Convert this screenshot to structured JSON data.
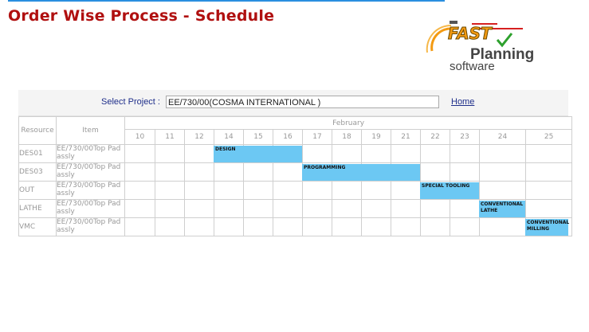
{
  "page": {
    "title": "Order Wise Process - Schedule"
  },
  "logo": {
    "word1": "FAST",
    "word2": "Planning",
    "word3": "software",
    "colors": {
      "orange": "#f39a12",
      "green": "#2ea12e",
      "red": "#d62020"
    }
  },
  "selector": {
    "label": "Select Project :",
    "value": "EE/730/00(COSMA INTERNATIONAL )",
    "home": "Home"
  },
  "grid": {
    "resource_header": "Resource",
    "item_header": "Item",
    "month": "February",
    "days": [
      "10",
      "11",
      "12",
      "14",
      "15",
      "16",
      "17",
      "18",
      "19",
      "21",
      "22",
      "23",
      "24",
      "25"
    ],
    "rows": [
      {
        "resource": "DES01",
        "item": "EE/730/00Top Pad assly"
      },
      {
        "resource": "DES03",
        "item": "EE/730/00Top Pad assly"
      },
      {
        "resource": "OUT",
        "item": "EE/730/00Top Pad assly"
      },
      {
        "resource": "LATHE",
        "item": "EE/730/00Top Pad assly"
      },
      {
        "resource": "VMC",
        "item": "EE/730/00Top Pad assly"
      }
    ],
    "tasks": [
      {
        "row": 0,
        "start": "14",
        "end": "16",
        "label": "DESIGN"
      },
      {
        "row": 1,
        "start": "17",
        "end": "21",
        "label": "PROGRAMMING"
      },
      {
        "row": 2,
        "start": "22",
        "end": "23",
        "label": "SPECIAL TOOLING"
      },
      {
        "row": 3,
        "start": "24",
        "end": "24",
        "label": "CONVENTIONAL LATHE"
      },
      {
        "row": 4,
        "start": "25",
        "end": "25",
        "label": "CONVENTIONAL MILLING"
      }
    ],
    "bar_color": "#6cc8f3"
  }
}
